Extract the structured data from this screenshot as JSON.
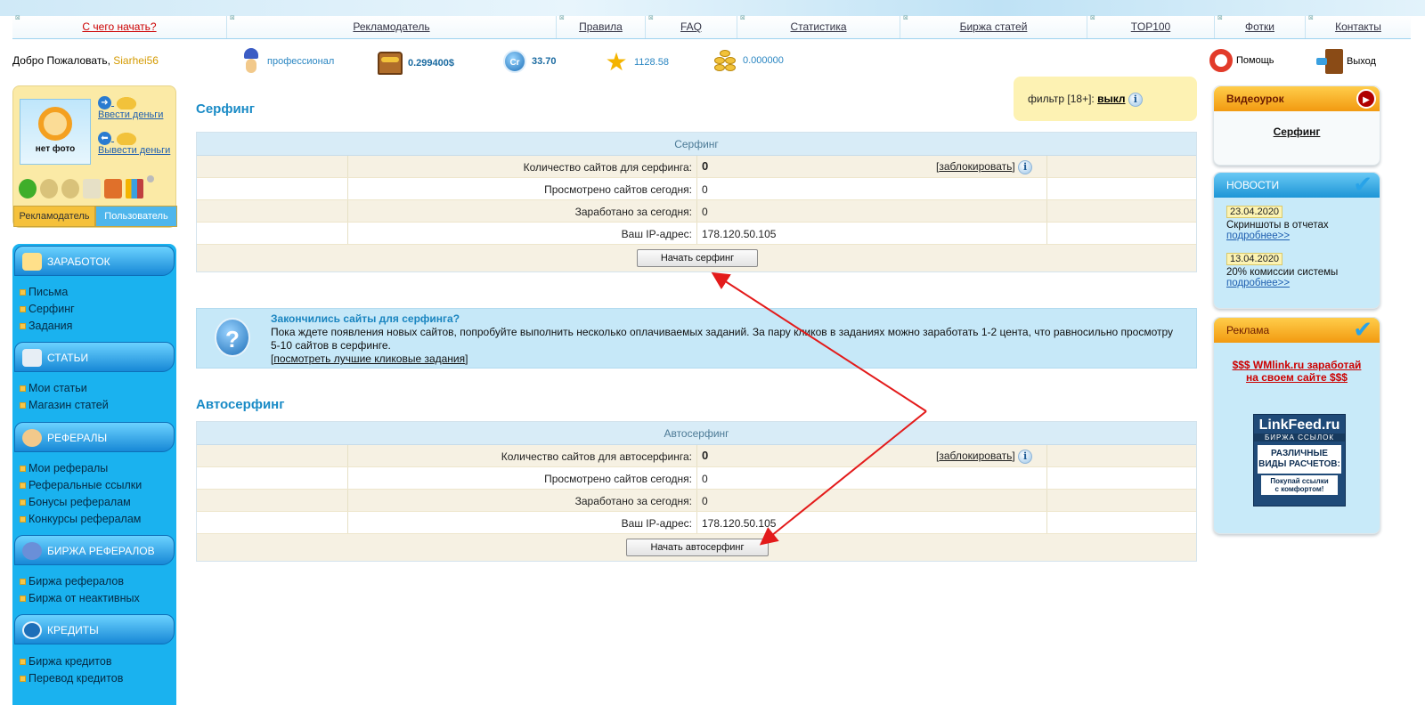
{
  "nav": {
    "items": [
      {
        "label": "С чего начать?",
        "active": true
      },
      {
        "label": "Рекламодатель"
      },
      {
        "label": "Правила"
      },
      {
        "label": "FAQ"
      },
      {
        "label": "Статистика"
      },
      {
        "label": "Биржа статей"
      },
      {
        "label": "TOP100"
      },
      {
        "label": "Фотки"
      },
      {
        "label": "Контакты"
      }
    ]
  },
  "status": {
    "welcome": "Добро Пожаловать,",
    "username": "Siarhei56",
    "rank": "профессионал",
    "balance": "0.299400$",
    "credits": "33.70",
    "rating": "1128.58",
    "coins": "0.000000",
    "help": "Помощь",
    "exit": "Выход"
  },
  "profile": {
    "no_photo": "нет фото",
    "deposit": "Ввести деньги",
    "withdraw": "Вывести деньги",
    "tab_advertiser": "Рекламодатель",
    "tab_user": "Пользователь"
  },
  "menu": {
    "earnings": {
      "title": "ЗАРАБОТОК",
      "items": [
        "Письма",
        "Серфинг",
        "Задания"
      ]
    },
    "articles": {
      "title": "СТАТЬИ",
      "items": [
        "Мои статьи",
        "Магазин статей"
      ]
    },
    "referrals": {
      "title": "РЕФЕРАЛЫ",
      "items": [
        "Мои рефералы",
        "Реферальные ссылки",
        "Бонусы рефералам",
        "Конкурсы рефералам"
      ]
    },
    "ref_exchange": {
      "title": "БИРЖА РЕФЕРАЛОВ",
      "items": [
        "Биржа рефералов",
        "Биржа от неактивных"
      ]
    },
    "credits": {
      "title": "КРЕДИТЫ",
      "items": [
        "Биржа кредитов",
        "Перевод кредитов"
      ]
    }
  },
  "filter": {
    "label": "фильтр [18+]:",
    "value": "выкл"
  },
  "surfing": {
    "title": "Серфинг",
    "panel_title": "Серфинг",
    "rows": [
      {
        "label": "Количество сайтов для серфинга:",
        "value": "0"
      },
      {
        "label": "Просмотрено сайтов сегодня:",
        "value": "0"
      },
      {
        "label": "Заработано за сегодня:",
        "value": "0"
      },
      {
        "label": "Ваш IP-адрес:",
        "value": "178.120.50.105"
      }
    ],
    "block_link": "заблокировать",
    "button": "Начать серфинг"
  },
  "notice": {
    "title": "Закончились сайты для серфинга?",
    "text": "Пока ждете появления новых сайтов, попробуйте выполнить несколько оплачиваемых заданий. За пару кликов в заданиях можно заработать 1-2 цента, что равносильно просмотру 5-10 сайтов в серфинге.",
    "link": "посмотреть лучшие кликовые задания"
  },
  "autosurfing": {
    "title": "Автосерфинг",
    "panel_title": "Автосерфинг",
    "rows": [
      {
        "label": "Количество сайтов для автосерфинга:",
        "value": "0"
      },
      {
        "label": "Просмотрено сайтов сегодня:",
        "value": "0"
      },
      {
        "label": "Заработано за сегодня:",
        "value": "0"
      },
      {
        "label": "Ваш IP-адрес:",
        "value": "178.120.50.105"
      }
    ],
    "block_link": "заблокировать",
    "button": "Начать автосерфинг"
  },
  "right": {
    "video": {
      "title": "Видеоурок",
      "link": "Серфинг"
    },
    "news": {
      "title": "НОВОСТИ",
      "items": [
        {
          "date": "23.04.2020",
          "text": "Скриншоты в отчетах",
          "more": "подробнее>>"
        },
        {
          "date": "13.04.2020",
          "text": "20% комиссии системы",
          "more": "подробнее>>"
        }
      ]
    },
    "ads": {
      "title": "Реклама",
      "link_line1": "$$$ WMlink.ru заработай",
      "link_line2": "на своем сайте $$$",
      "banner_title": "LinkFeed.ru",
      "banner_sub": "БИРЖА ССЫЛОК",
      "banner_mid1": "РАЗЛИЧНЫЕ",
      "banner_mid2": "ВИДЫ РАСЧЕТОВ:",
      "banner_bottom1": "Покупай ссылки",
      "banner_bottom2": "с комфортом!"
    }
  },
  "colors": {
    "accent": "#1a8bc6",
    "arrow": "#e31b1b",
    "menu_bg": "#1ab2ef"
  }
}
